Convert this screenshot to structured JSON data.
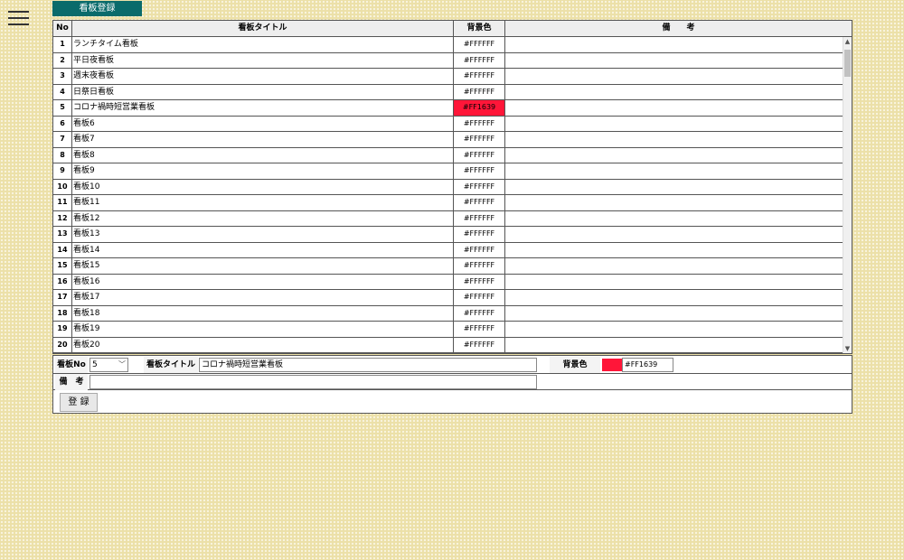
{
  "header": {
    "tab_label": "看板登録"
  },
  "table": {
    "columns": {
      "no": "No",
      "title": "看板タイトル",
      "color": "背景色",
      "note": "備　　考"
    },
    "rows": [
      {
        "no": "1",
        "title": "ランチタイム看板",
        "color": "#FFFFFF",
        "bg": "#FFFFFF"
      },
      {
        "no": "2",
        "title": "平日夜看板",
        "color": "#FFFFFF",
        "bg": "#FFFFFF"
      },
      {
        "no": "3",
        "title": "週末夜看板",
        "color": "#FFFFFF",
        "bg": "#FFFFFF"
      },
      {
        "no": "4",
        "title": "日祭日看板",
        "color": "#FFFFFF",
        "bg": "#FFFFFF"
      },
      {
        "no": "5",
        "title": "コロナ禍時短営業看板",
        "color": "#FF1639",
        "bg": "#FF1639"
      },
      {
        "no": "6",
        "title": "看板6",
        "color": "#FFFFFF",
        "bg": "#FFFFFF"
      },
      {
        "no": "7",
        "title": "看板7",
        "color": "#FFFFFF",
        "bg": "#FFFFFF"
      },
      {
        "no": "8",
        "title": "看板8",
        "color": "#FFFFFF",
        "bg": "#FFFFFF"
      },
      {
        "no": "9",
        "title": "看板9",
        "color": "#FFFFFF",
        "bg": "#FFFFFF"
      },
      {
        "no": "10",
        "title": "看板10",
        "color": "#FFFFFF",
        "bg": "#FFFFFF"
      },
      {
        "no": "11",
        "title": "看板11",
        "color": "#FFFFFF",
        "bg": "#FFFFFF"
      },
      {
        "no": "12",
        "title": "看板12",
        "color": "#FFFFFF",
        "bg": "#FFFFFF"
      },
      {
        "no": "13",
        "title": "看板13",
        "color": "#FFFFFF",
        "bg": "#FFFFFF"
      },
      {
        "no": "14",
        "title": "看板14",
        "color": "#FFFFFF",
        "bg": "#FFFFFF"
      },
      {
        "no": "15",
        "title": "看板15",
        "color": "#FFFFFF",
        "bg": "#FFFFFF"
      },
      {
        "no": "16",
        "title": "看板16",
        "color": "#FFFFFF",
        "bg": "#FFFFFF"
      },
      {
        "no": "17",
        "title": "看板17",
        "color": "#FFFFFF",
        "bg": "#FFFFFF"
      },
      {
        "no": "18",
        "title": "看板18",
        "color": "#FFFFFF",
        "bg": "#FFFFFF"
      },
      {
        "no": "19",
        "title": "看板19",
        "color": "#FFFFFF",
        "bg": "#FFFFFF"
      },
      {
        "no": "20",
        "title": "看板20",
        "color": "#FFFFFF",
        "bg": "#FFFFFF"
      }
    ]
  },
  "form": {
    "no_label": "看板No",
    "no_value": "5",
    "title_label": "看板タイトル",
    "title_value": "コロナ禍時短営業看板",
    "color_label": "背景色",
    "color_value": "#FF1639",
    "swatch_color": "#FF1639",
    "note_label": "備　考",
    "note_value": "",
    "register_label": "登 録"
  },
  "icons": {
    "menu": "hamburger-menu-icon",
    "chevron": "chevron-down-icon"
  }
}
